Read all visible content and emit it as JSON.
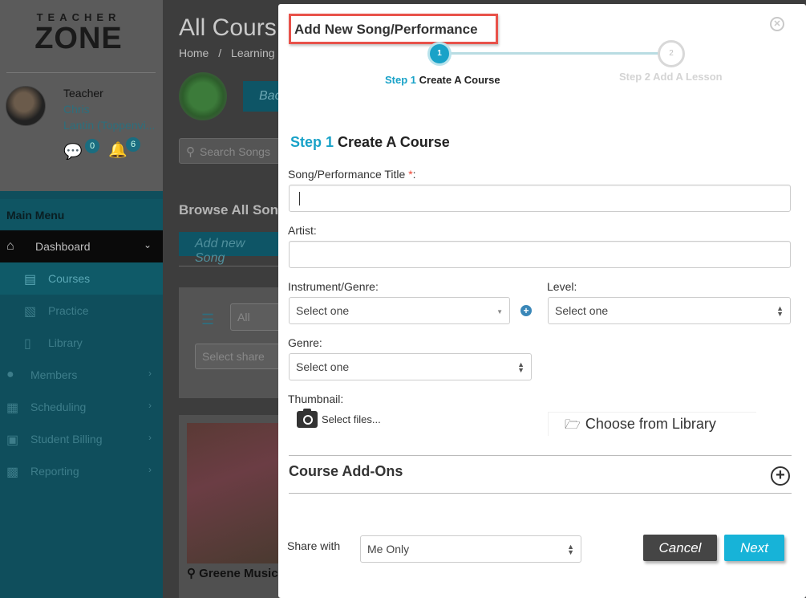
{
  "logo": {
    "line1": "TEACHER",
    "line2": "ZONE"
  },
  "user": {
    "role": "Teacher",
    "first_name": "Chris",
    "last_name": "Lantin (Toppenvi..."
  },
  "notifications": {
    "messages": "0",
    "alerts": "6"
  },
  "sidebar": {
    "heading": "Main Menu",
    "items": [
      {
        "label": "Dashboard",
        "icon": "home-icon"
      },
      {
        "label": "Courses",
        "icon": "book-icon"
      },
      {
        "label": "Practice",
        "icon": "document-icon"
      },
      {
        "label": "Library",
        "icon": "file-icon"
      },
      {
        "label": "Members",
        "icon": "users-icon"
      },
      {
        "label": "Scheduling",
        "icon": "calendar-icon"
      },
      {
        "label": "Student Billing",
        "icon": "cart-icon"
      },
      {
        "label": "Reporting",
        "icon": "bar-chart-icon"
      }
    ]
  },
  "main": {
    "title": "All Cours",
    "breadcrumb_home": "Home",
    "breadcrumb_sep": "/",
    "breadcrumb_current": "Learning",
    "back_label": "Bac",
    "search_placeholder": "Search Songs",
    "browse_heading": "Browse All Son",
    "add_song_label": "Add new Song",
    "filter_all": "All",
    "filter_share": "Select share",
    "card_title": "Greene Music"
  },
  "modal": {
    "title": "Add New Song/Performance",
    "step1_num": "Step 1",
    "step1_text": "Create A Course",
    "step1_dot": "1",
    "step2_dot": "2",
    "step2_label": "Step 2 Add A Lesson",
    "section_num": "Step 1",
    "section_text": "Create A Course",
    "song_title_label": "Song/Performance Title",
    "required_mark": "*",
    "label_colon": ":",
    "artist_label": "Artist:",
    "instrument_label": "Instrument/Genre:",
    "instrument_value": "Select one",
    "level_label": "Level:",
    "level_value": "Select one",
    "genre_label": "Genre:",
    "genre_value": "Select one",
    "thumbnail_label": "Thumbnail:",
    "select_files": "Select files...",
    "choose_library": "Choose from Library",
    "addons_label": "Course Add-Ons",
    "share_label": "Share with",
    "share_value": "Me Only",
    "cancel_label": "Cancel",
    "next_label": "Next"
  },
  "colors": {
    "accent": "#19a2c8",
    "next_button": "#17b3d8",
    "cancel_button": "#454545",
    "highlight_border": "#e8524a"
  }
}
